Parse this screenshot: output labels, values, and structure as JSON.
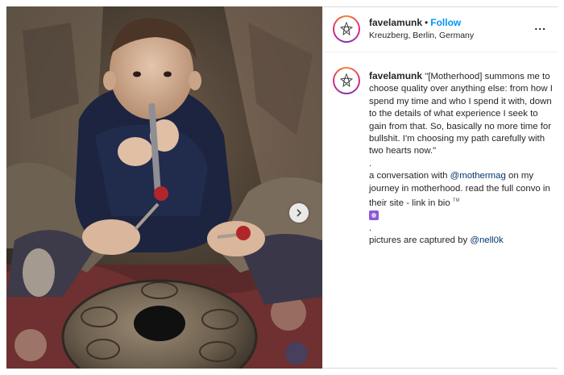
{
  "post": {
    "username": "favelamunk",
    "separator": "•",
    "follow_label": "Follow",
    "location": "Kreuzberg, Berlin, Germany",
    "more_label": "...",
    "caption": {
      "username": "favelamunk",
      "quote": "\"[Motherhood] summons me to choose quality over anything else: from how I spend my time and who I spend it with, down to the details of what experience I seek to gain from that. So, basically no more time for bullshit. I'm choosing my path carefully with two hearts now.\"",
      "dot1": ".",
      "line2_pre": "a conversation with ",
      "mention1": "@mothermag",
      "line2_post": " on my journey in motherhood. read the full convo in their site - link in bio ",
      "tm": "TM",
      "dot2": ".",
      "line3_pre": "pictures are captured by ",
      "mention2": "@nell0k"
    }
  },
  "icons": {
    "avatar": "mandala-logo-icon",
    "next": "chevron-right-icon",
    "more": "more-options-icon",
    "emoji": "purple-circle-emoji-icon"
  }
}
